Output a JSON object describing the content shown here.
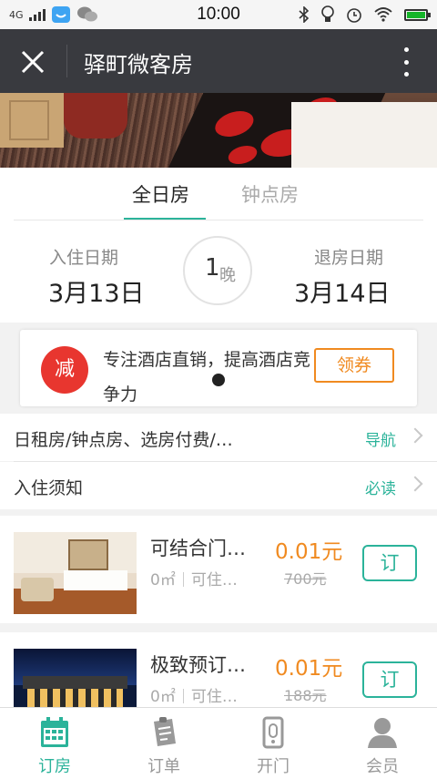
{
  "status_bar": {
    "network": "4G",
    "time": "10:00"
  },
  "nav": {
    "title": "驿町微客房"
  },
  "tabs": [
    {
      "label": "全日房",
      "active": true
    },
    {
      "label": "钟点房",
      "active": false
    }
  ],
  "dates": {
    "checkin_label": "入住日期",
    "checkin_value": "3月13日",
    "nights_number": "1",
    "nights_unit": "晚",
    "checkout_label": "退房日期",
    "checkout_value": "3月14日"
  },
  "coupon": {
    "badge": "减",
    "text": "专注酒店直销，提高酒店竞争力",
    "button": "领券"
  },
  "info_rows": [
    {
      "label": "日租房/钟点房、选房付费/…",
      "link": "导航"
    },
    {
      "label": "入住须知",
      "link": "必读"
    }
  ],
  "rooms": [
    {
      "name": "可结合门…",
      "area": "0㎡",
      "capacity": "可住…",
      "price": "0.01元",
      "original_price": "700元",
      "button": "订"
    },
    {
      "name": "极致预订…",
      "area": "0㎡",
      "capacity": "可住…",
      "price": "0.01元",
      "original_price": "188元",
      "button": "订"
    }
  ],
  "tab_bar": [
    {
      "label": "订房",
      "icon": "calendar-icon",
      "active": true
    },
    {
      "label": "订单",
      "icon": "order-icon",
      "active": false
    },
    {
      "label": "开门",
      "icon": "door-phone-icon",
      "active": false
    },
    {
      "label": "会员",
      "icon": "member-icon",
      "active": false
    }
  ],
  "colors": {
    "accent": "#2bb39a",
    "price": "#f08a20",
    "badge": "#e8362f",
    "navbar": "#393a3f"
  }
}
